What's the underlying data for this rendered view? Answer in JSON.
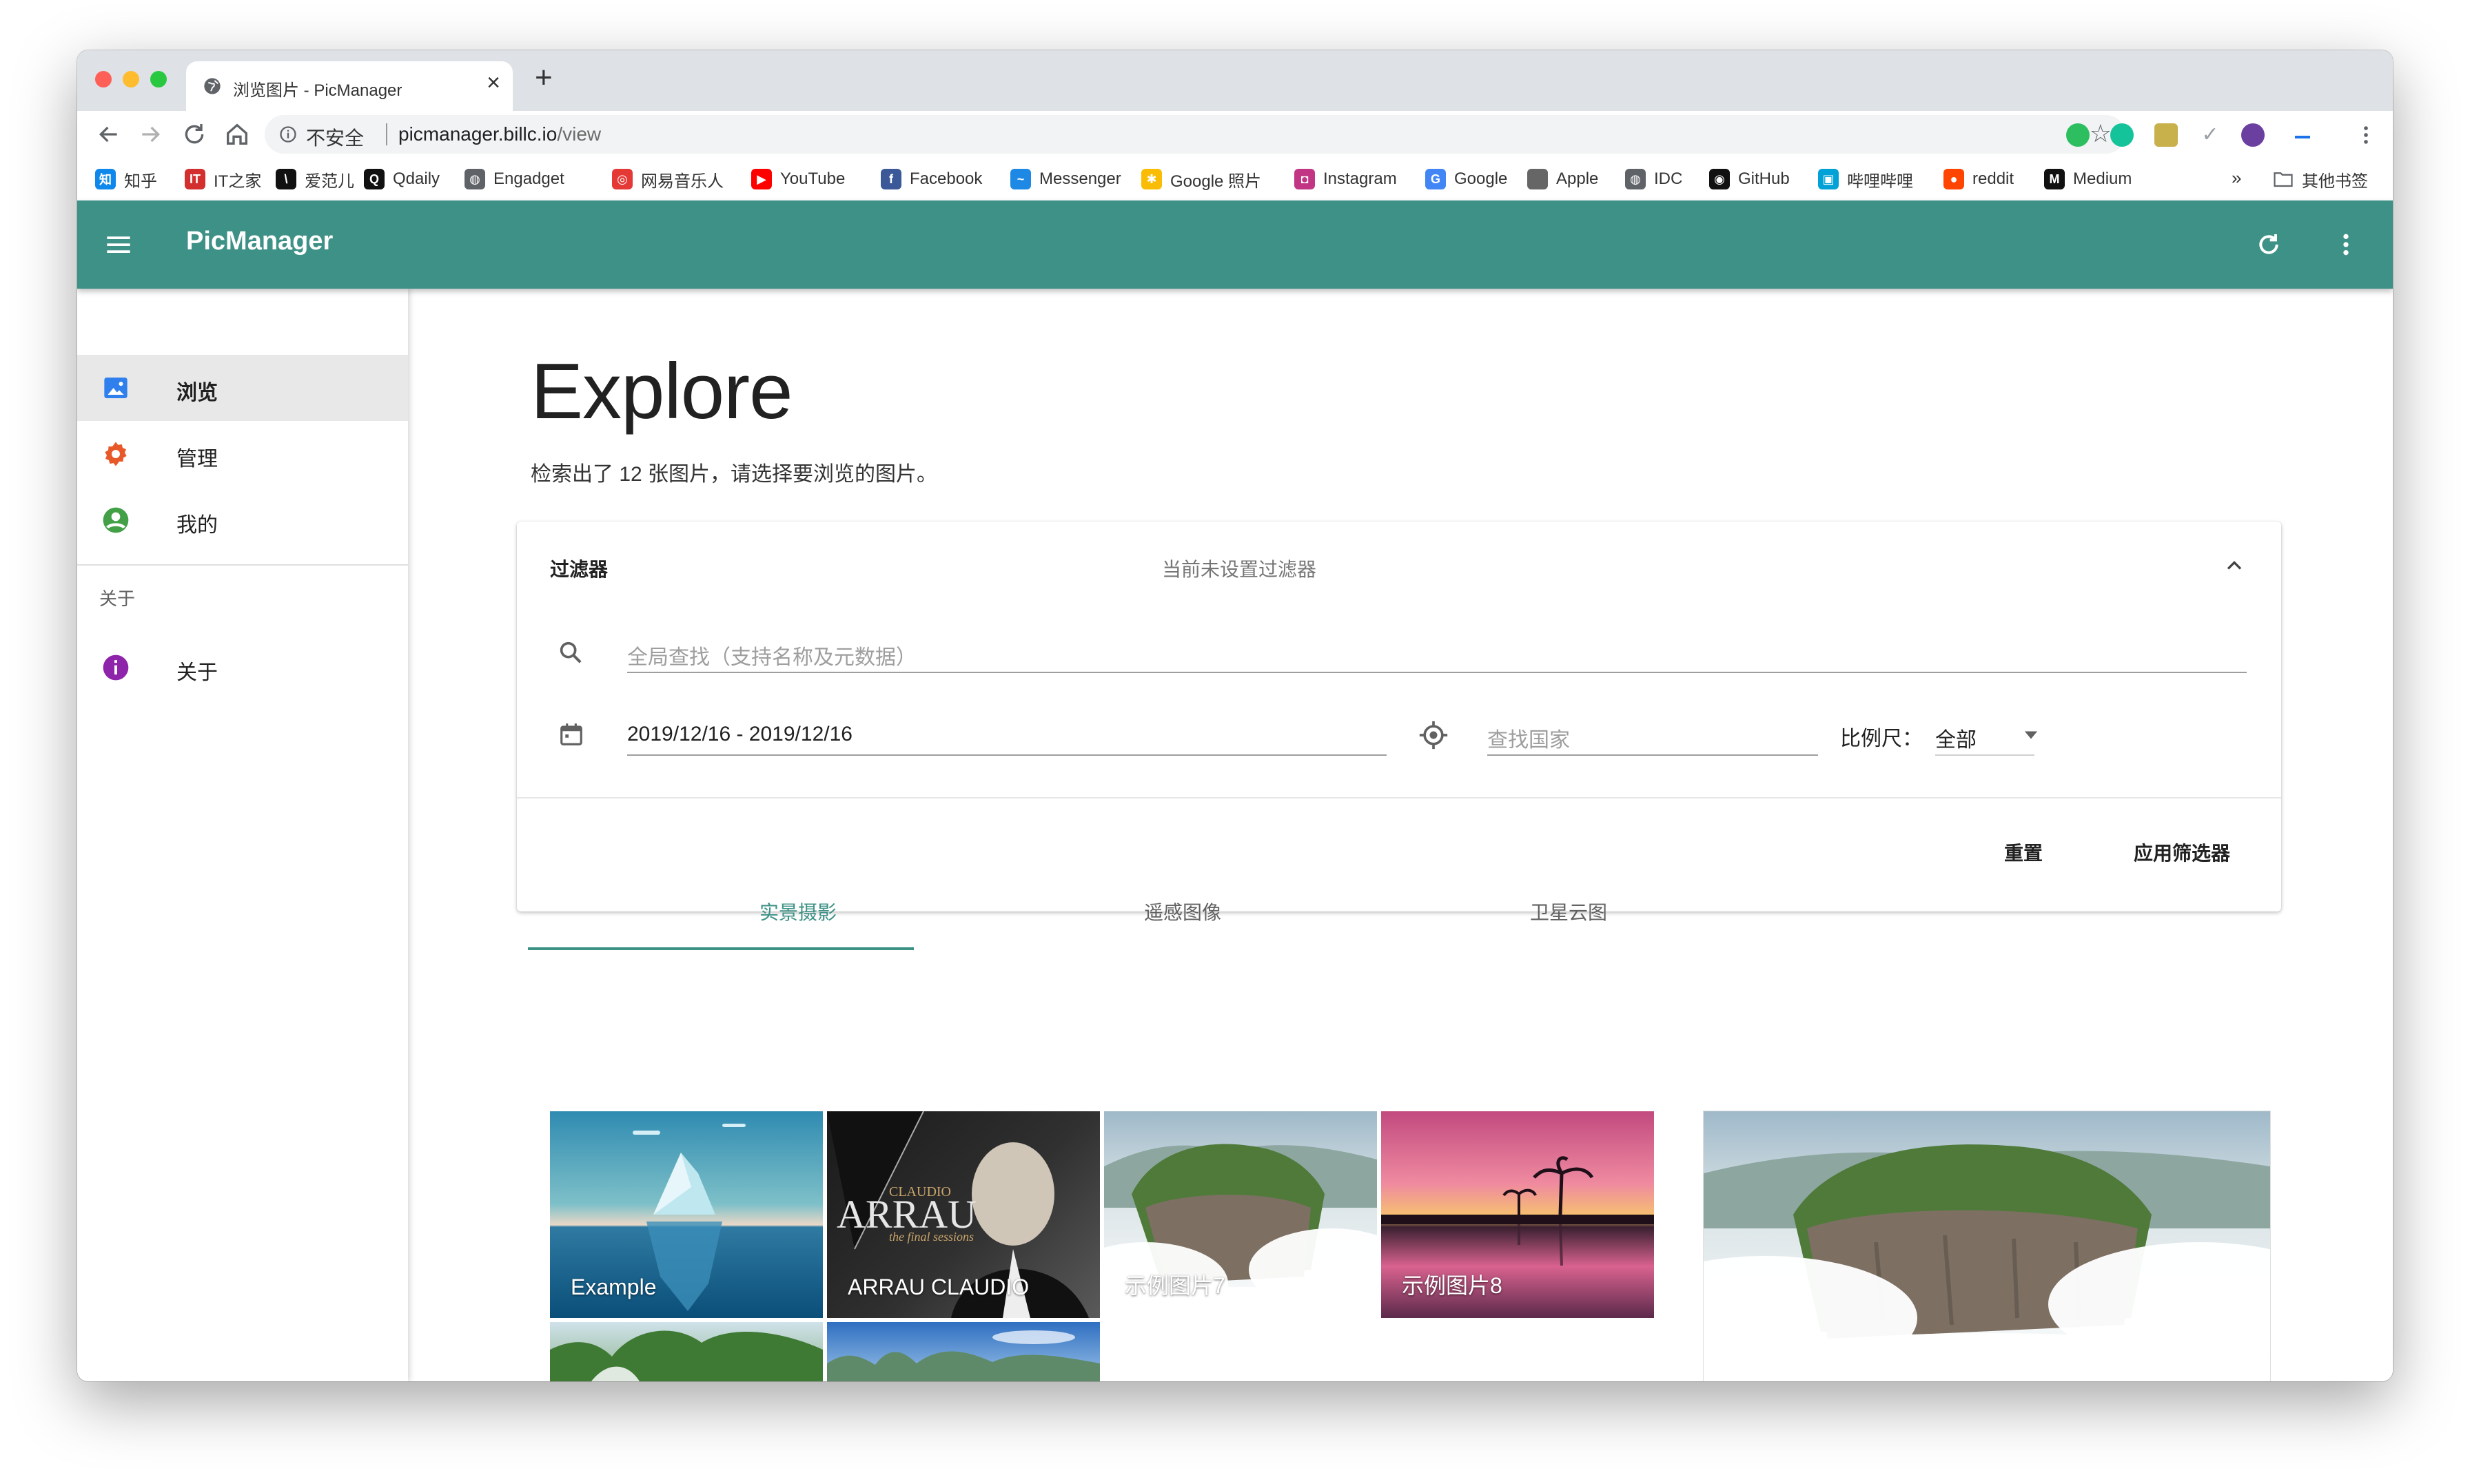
{
  "browser": {
    "tab_title": "浏览图片 - PicManager",
    "new_tab": "+",
    "close": "×",
    "security_label": "不安全",
    "url_host": "picmanager.billc.io",
    "url_path": "/view"
  },
  "bookmarks": [
    {
      "label": "知乎",
      "icon": "zhihu-icon",
      "color": "#0f88eb",
      "glyph": "知"
    },
    {
      "label": "IT之家",
      "icon": "ithome-icon",
      "color": "#d32f2f",
      "glyph": "IT"
    },
    {
      "label": "爱范儿",
      "icon": "ifanr-icon",
      "color": "#111111",
      "glyph": "\\"
    },
    {
      "label": "Qdaily",
      "icon": "qdaily-icon",
      "color": "#111111",
      "glyph": "Q"
    },
    {
      "label": "Engadget",
      "icon": "globe-icon",
      "color": "#5f6368",
      "glyph": "◍"
    },
    {
      "label": "网易音乐人",
      "icon": "netease-icon",
      "color": "#e53935",
      "glyph": "◎"
    },
    {
      "label": "YouTube",
      "icon": "youtube-icon",
      "color": "#ff0000",
      "glyph": "▶"
    },
    {
      "label": "Facebook",
      "icon": "facebook-icon",
      "color": "#3b5998",
      "glyph": "f"
    },
    {
      "label": "Messenger",
      "icon": "messenger-icon",
      "color": "#1e88e5",
      "glyph": "~"
    },
    {
      "label": "Google 照片",
      "icon": "google-photos-icon",
      "color": "#fbbc05",
      "glyph": "✱"
    },
    {
      "label": "Instagram",
      "icon": "instagram-icon",
      "color": "#c13584",
      "glyph": "◘"
    },
    {
      "label": "Google",
      "icon": "google-icon",
      "color": "#4285f4",
      "glyph": "G"
    },
    {
      "label": "Apple",
      "icon": "apple-icon",
      "color": "#666666",
      "glyph": ""
    },
    {
      "label": "IDC",
      "icon": "globe-icon",
      "color": "#5f6368",
      "glyph": "◍"
    },
    {
      "label": "GitHub",
      "icon": "github-icon",
      "color": "#111111",
      "glyph": "◉"
    },
    {
      "label": "哔哩哔哩",
      "icon": "bilibili-icon",
      "color": "#00a1d6",
      "glyph": "▣"
    },
    {
      "label": "reddit",
      "icon": "reddit-icon",
      "color": "#ff4500",
      "glyph": "●"
    },
    {
      "label": "Medium",
      "icon": "medium-icon",
      "color": "#111111",
      "glyph": "M"
    }
  ],
  "bookmarks_more": "»",
  "bookmarks_other": "其他书签",
  "app": {
    "title": "PicManager",
    "primary_color": "#3d9186"
  },
  "sidebar": {
    "items": [
      {
        "label": "浏览",
        "icon": "image-icon",
        "selected": true
      },
      {
        "label": "管理",
        "icon": "gear-icon",
        "selected": false
      },
      {
        "label": "我的",
        "icon": "account-icon",
        "selected": false
      }
    ],
    "section_header": "关于",
    "about_item": {
      "label": "关于",
      "icon": "info-icon"
    }
  },
  "main": {
    "heading": "Explore",
    "result_text": "检索出了 12 张图片，请选择要浏览的图片。",
    "filter": {
      "title": "过滤器",
      "status": "当前未设置过滤器",
      "search_placeholder": "全局查找（支持名称及元数据）",
      "date_range": "2019/12/16 - 2019/12/16",
      "country_placeholder": "查找国家",
      "ratio_label": "比例尺：",
      "ratio_value": "全部",
      "reset_label": "重置",
      "apply_label": "应用筛选器"
    },
    "tabs": [
      {
        "label": "实景摄影",
        "active": true
      },
      {
        "label": "遥感图像",
        "active": false
      },
      {
        "label": "卫星云图",
        "active": false
      }
    ],
    "gallery": [
      {
        "caption": "Example"
      },
      {
        "caption": "ARRAU CLAUDIO"
      },
      {
        "caption": "示例图片7"
      },
      {
        "caption": "示例图片8"
      }
    ],
    "album_text": {
      "top": "CLAUDIO",
      "main": "ARRAU",
      "sub": "the final sessions"
    }
  }
}
